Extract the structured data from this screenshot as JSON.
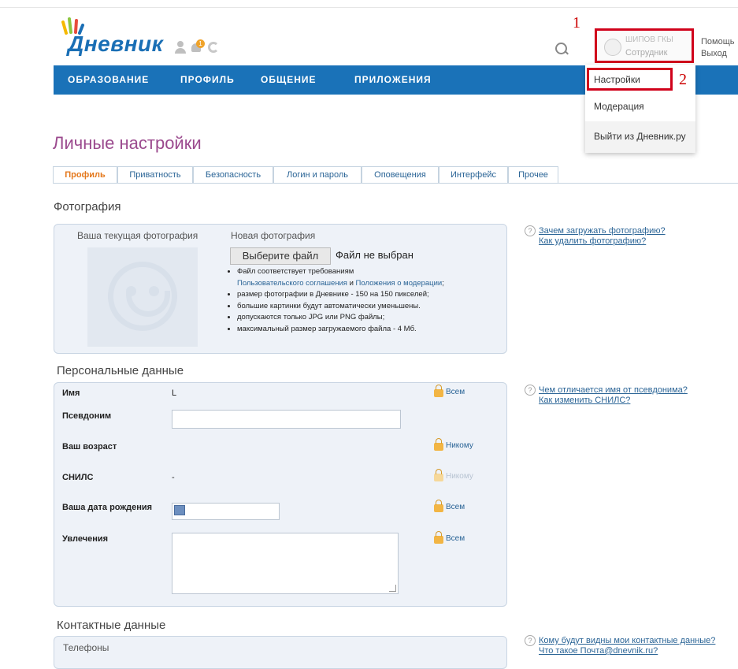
{
  "header": {
    "logo_text": "Дневник",
    "notification_count": "1",
    "user_name": "ШИПОВ ГКЫ",
    "user_role": "Сотрудник",
    "help_label": "Помощь",
    "logout_label": "Выход",
    "annotation_1": "1",
    "annotation_2": "2"
  },
  "nav": {
    "items": [
      "ОБРАЗОВАНИЕ",
      "ПРОФИЛЬ",
      "ОБЩЕНИЕ",
      "ПРИЛОЖЕНИЯ"
    ]
  },
  "user_menu": {
    "items": [
      "Настройки",
      "Модерация",
      "Выйти из Дневник.ру"
    ]
  },
  "page": {
    "title": "Личные настройки",
    "tabs": [
      "Профиль",
      "Приватность",
      "Безопасность",
      "Логин и пароль",
      "Оповещения",
      "Интерфейс",
      "Прочее"
    ],
    "active_tab": "Профиль"
  },
  "photo": {
    "section_title": "Фотография",
    "current_label": "Ваша текущая фотография",
    "new_label": "Новая фотография",
    "choose_button": "Выберите файл",
    "file_status": "Файл не выбран",
    "rule_1_prefix": "Файл соответствует требованиям",
    "rule_1_link_1": "Пользовательского соглашения",
    "rule_1_and": " и ",
    "rule_1_link_2": "Положения о модерации",
    "rule_1_suffix": ";",
    "rule_2": "размер фотографии в Дневнике - 150 на 150 пикселей;",
    "rule_3": "большие картинки будут автоматически уменьшены.",
    "rule_4": "допускаются только JPG или PNG файлы;",
    "rule_5": "максимальный размер загружаемого файла - 4 Мб.",
    "help_link_1": "Зачем загружать фотографию?",
    "help_link_2": "Как удалить фотографию?"
  },
  "personal": {
    "section_title": "Персональные данные",
    "name_label": "Имя",
    "name_value": "L",
    "name_privacy": "Всем",
    "nickname_label": "Псевдоним",
    "nickname_value": "",
    "age_label": "Ваш возраст",
    "age_privacy": "Никому",
    "snils_label": "СНИЛС",
    "snils_value": "-",
    "snils_privacy": "Никому",
    "birthdate_label": "Ваша дата рождения",
    "birthdate_privacy": "Всем",
    "hobbies_label": "Увлечения",
    "hobbies_privacy": "Всем",
    "help_link_1": "Чем отличается имя от псевдонима?",
    "help_link_2": "Как изменить СНИЛС?"
  },
  "contacts": {
    "section_title": "Контактные данные",
    "phones_label": "Телефоны",
    "help_link_1": "Кому будут видны мои контактные данные?",
    "help_link_2": "Что такое Почта@dnevnik.ru?"
  },
  "colors": {
    "nav_blue": "#1a72b8",
    "title_purple": "#9b4a8e",
    "active_tab_orange": "#e4781c",
    "annotation_red": "#d0021b"
  }
}
